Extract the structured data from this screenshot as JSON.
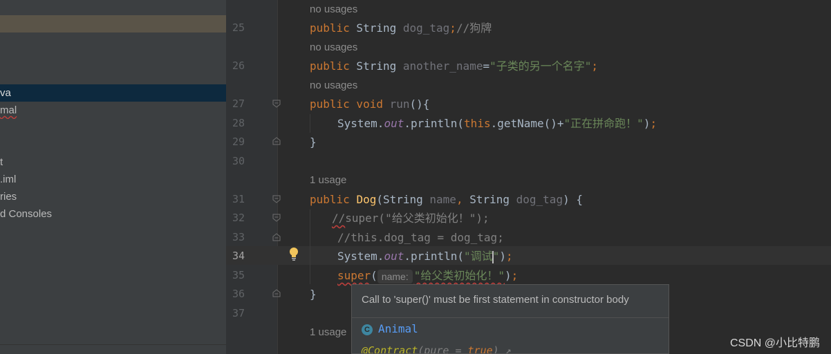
{
  "sidebar": {
    "items": [
      {
        "label": "",
        "state": "highlighted"
      },
      {
        "label": "va",
        "state": "selected"
      },
      {
        "label": "mal",
        "state": "error"
      },
      {
        "label": "t",
        "state": "normal"
      },
      {
        "label": ".iml",
        "state": "normal"
      },
      {
        "label": "ries",
        "state": "normal"
      },
      {
        "label": "d Consoles",
        "state": "normal"
      }
    ]
  },
  "editor": {
    "hints": {
      "h1": "no usages",
      "h2": "no usages",
      "h3": "no usages",
      "h4": "1 usage",
      "h5": "1 usage"
    },
    "line_numbers": [
      "25",
      "26",
      "27",
      "28",
      "29",
      "30",
      "31",
      "32",
      "33",
      "34",
      "35",
      "36",
      "37"
    ],
    "current_line": "34",
    "lines": {
      "l25": {
        "kw": "public",
        "type": " String ",
        "field": "dog_tag",
        "sep": ";",
        "cmt": "//狗牌"
      },
      "l26": {
        "kw": "public",
        "type": " String ",
        "field": "another_name",
        "eq": "=",
        "str": "\"子类的另一个名字\"",
        "sep": ";"
      },
      "l27": {
        "kw1": "public",
        "kw2": " void ",
        "name": "run",
        "rest": "(){"
      },
      "l28": {
        "a": "System.",
        "out": "out",
        "b": ".println(",
        "kw": "this",
        "c": ".getName()+",
        "str": "\"正在拼命跑！\"",
        "d": ")",
        "sep": ";"
      },
      "l29": {
        "brace": "}"
      },
      "l31": {
        "kw": "public",
        "ctor": "Dog",
        "a": "(String ",
        "p1": "name",
        "comma": ",",
        "b": " String ",
        "p2": "dog_tag",
        "c": ") {"
      },
      "l32": {
        "slashes": "//",
        "rest": "super(\"给父类初始化！\");"
      },
      "l33": {
        "cmt": "//this.dog_tag = dog_tag;"
      },
      "l34": {
        "a": "System.",
        "out": "out",
        "b": ".println(",
        "str1": "\"调试",
        "str2": "\"",
        "c": ")",
        "sep": ";"
      },
      "l35": {
        "kw": "super",
        "paren": "(",
        "inlay": "name:",
        "str": "\"给父类初始化！\"",
        "c": ")",
        "sep": ";"
      },
      "l36": {
        "brace": "}"
      }
    }
  },
  "popup": {
    "message": "Call to 'super()' must be first statement in constructor body",
    "class_icon": "C",
    "class_name": "Animal",
    "annotation": "@Contract",
    "anno_args_a": "(pure = ",
    "anno_true": "true",
    "anno_args_b": ")",
    "anno_more": " ↗"
  },
  "watermark": "CSDN @小比特鹏",
  "colors": {
    "keyword": "#cc7832",
    "string": "#6a8759",
    "comment": "#808080",
    "function": "#ffc66d",
    "error_underline": "#bc3f3c",
    "link": "#589df6"
  }
}
